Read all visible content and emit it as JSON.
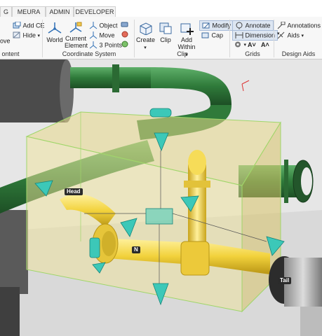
{
  "tabs": [
    "G",
    "MEURA",
    "ADMIN",
    "DEVELOPER"
  ],
  "ribbon": {
    "content": {
      "label": "ontent",
      "items": [
        "ove",
        "Add CE",
        "Hide"
      ]
    },
    "coordinate_system": {
      "label": "Coordinate System",
      "world": "World",
      "current_element_line1": "Current",
      "current_element_line2": "Element",
      "object": "Object",
      "move": "Move",
      "three_points": "3 Points"
    },
    "clip": {
      "label": "Clip",
      "create": "Create",
      "clip": "Clip",
      "add_within_line1": "Add",
      "add_within_line2": "Within",
      "modify": "Modify",
      "cap": "Cap"
    },
    "grids": {
      "label": "Grids",
      "annotate": "Annotate",
      "dimension": "Dimension"
    },
    "design_aids": {
      "label": "Design Aids",
      "annotations": "Annotations",
      "aids": "Aids"
    }
  },
  "viewport": {
    "labels": {
      "head": "Head",
      "north": "N",
      "tail": "Tail"
    },
    "colors": {
      "background": "#e9e9e9",
      "pipe_green": "#2f7a3a",
      "pipe_yellow": "#f2d23c",
      "clip_box": "#e8d98a",
      "clip_edges": "#9fd66a",
      "handles": "#3cc8b8"
    }
  }
}
